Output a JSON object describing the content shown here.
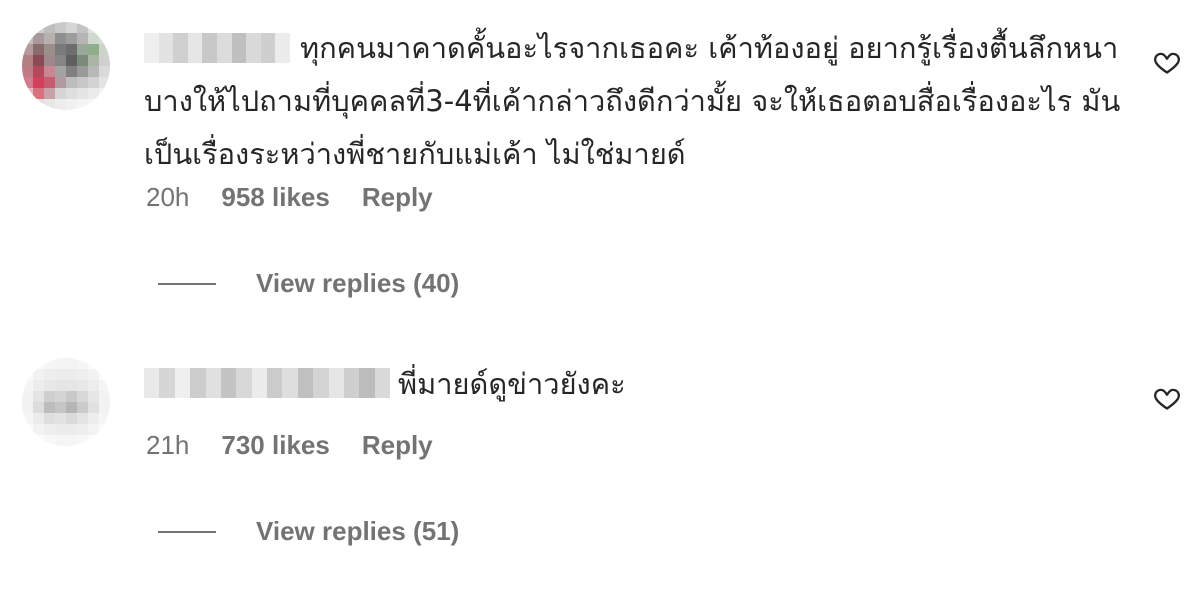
{
  "comments": [
    {
      "text": "ทุกคนมาคาดคั้นอะไรจากเธอคะ เค้าท้องอยู่ อยากรู้เรื่องตื้นลึกหนาบางให้ไปถามที่บุคคลที่3-4ที่เค้ากล่าวถึงดีกว่ามั้ย จะให้เธอตอบสื่อเรื่องอะไร มันเป็นเรื่องระหว่างพี่ชายกับแม่เค้า ไม่ใช่มายด์",
      "time": "20h",
      "likes": "958 likes",
      "reply": "Reply",
      "view_replies": "View replies (40)",
      "like_icon": "heart-outline-icon"
    },
    {
      "text": "พี่มายด์ดูข่าวยังคะ",
      "time": "21h",
      "likes": "730 likes",
      "reply": "Reply",
      "view_replies": "View replies (51)",
      "like_icon": "heart-outline-icon"
    }
  ],
  "colors": {
    "text": "#262626",
    "secondary": "#737373",
    "background": "#ffffff"
  }
}
